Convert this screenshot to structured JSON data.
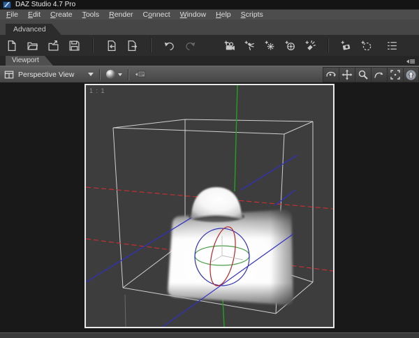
{
  "window": {
    "title": "DAZ Studio 4.7 Pro"
  },
  "menu": {
    "items": [
      {
        "label": "File",
        "mnemonic_index": 0
      },
      {
        "label": "Edit",
        "mnemonic_index": 0
      },
      {
        "label": "Create",
        "mnemonic_index": 0
      },
      {
        "label": "Tools",
        "mnemonic_index": 0
      },
      {
        "label": "Render",
        "mnemonic_index": 0
      },
      {
        "label": "Connect",
        "mnemonic_index": 1
      },
      {
        "label": "Window",
        "mnemonic_index": 0
      },
      {
        "label": "Help",
        "mnemonic_index": 0
      },
      {
        "label": "Scripts",
        "mnemonic_index": 0
      }
    ]
  },
  "workspace": {
    "active_tab": "Advanced"
  },
  "main_toolbar": {
    "file_icons": [
      "new-file",
      "open-file",
      "open-merge",
      "save-file",
      "import-file",
      "export-file",
      "undo",
      "redo"
    ],
    "create_icons": [
      "new-camera",
      "new-spotlight",
      "new-point-light",
      "new-distant-light",
      "new-linear-point-light",
      "new-view-camera",
      "new-node",
      "scene-list"
    ],
    "corner_icon": "pane-menu"
  },
  "viewport_pane": {
    "tab_label": "Viewport",
    "view_selector_label": "Perspective View",
    "drawstyle_icon": "drawstyle-sphere",
    "pane_options_icon": "pane-options",
    "scale_label": "1 : 1",
    "camera_tools": [
      "orbit",
      "pan",
      "dolly-zoom",
      "rotate",
      "frame",
      "aim"
    ]
  },
  "scene": {
    "colors": {
      "axis_red": "#c63030",
      "axis_green": "#21a321",
      "axis_blue": "#3030c8",
      "gizmo_red": "#b52525",
      "gizmo_green": "#4aa04a",
      "gizmo_blue": "#3434b4",
      "wireframe": "#dcdcdc",
      "background": "#3d3d3d"
    }
  }
}
